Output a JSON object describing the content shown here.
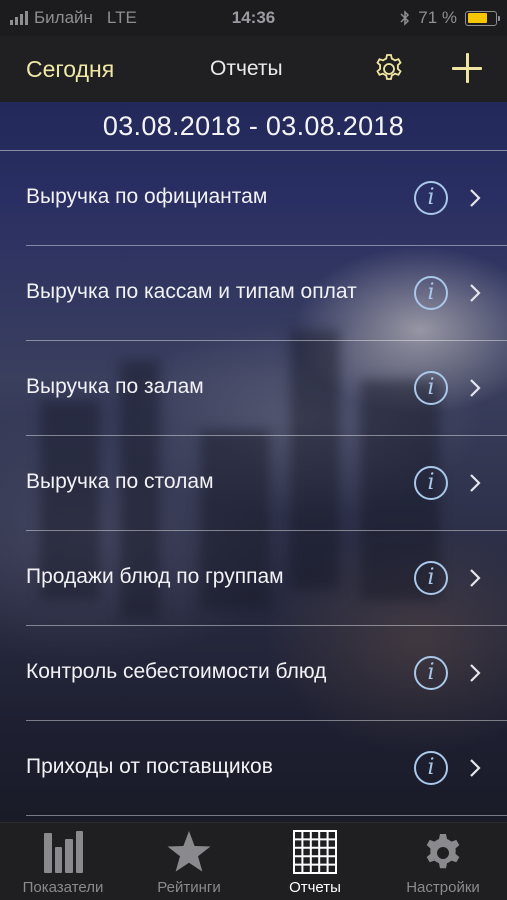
{
  "status_bar": {
    "carrier": "Билайн",
    "network": "LTE",
    "time": "14:36",
    "battery": "71 %",
    "battery_level": 0.71
  },
  "nav": {
    "left_label": "Сегодня",
    "title": "Отчеты",
    "settings_icon": "gear-icon",
    "add_icon": "plus-icon"
  },
  "date_range": "03.08.2018 - 03.08.2018",
  "reports": [
    {
      "label": "Выручка по официантам"
    },
    {
      "label": "Выручка по кассам и типам оплат"
    },
    {
      "label": "Выручка по залам"
    },
    {
      "label": "Выручка по столам"
    },
    {
      "label": "Продажи блюд по группам"
    },
    {
      "label": "Контроль себестоимости блюд"
    },
    {
      "label": "Приходы от поставщиков"
    }
  ],
  "tabs": [
    {
      "label": "Показатели",
      "icon": "chart-icon",
      "active": false
    },
    {
      "label": "Рейтинги",
      "icon": "star-icon",
      "active": false
    },
    {
      "label": "Отчеты",
      "icon": "grid-icon",
      "active": true
    },
    {
      "label": "Настройки",
      "icon": "gear-icon",
      "active": false
    }
  ],
  "colors": {
    "accent": "#efe7a6",
    "info": "#a9c8ea",
    "tab_inactive": "#8a8a8e",
    "battery": "#f7c600"
  }
}
